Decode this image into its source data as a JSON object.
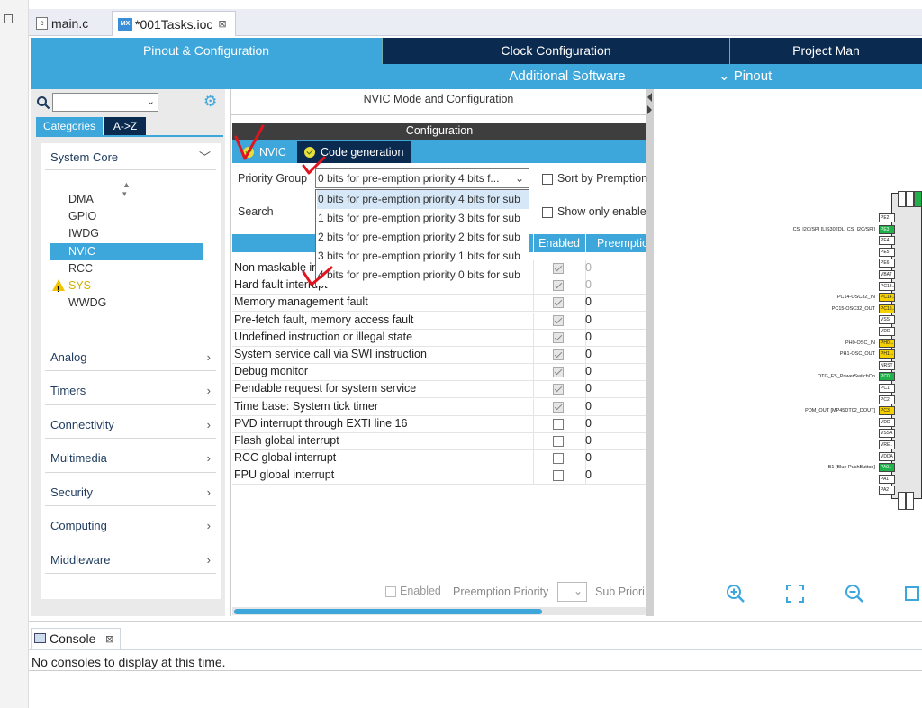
{
  "editor_tabs": [
    {
      "label": "main.c",
      "icon": "c-file-icon"
    },
    {
      "label": "*001Tasks.ioc",
      "icon": "mx-file-icon",
      "close": "⊠"
    }
  ],
  "nav": {
    "pinout_config": "Pinout & Configuration",
    "clock_config": "Clock Configuration",
    "project_manager": "Project Man",
    "additional_software": "Additional Software",
    "pinout": "Pinout"
  },
  "sidebar": {
    "search_value": "",
    "tab_categories": "Categories",
    "tab_az": "A->Z",
    "system_core": "System Core",
    "system_core_items": [
      "DMA",
      "GPIO",
      "IWDG",
      "NVIC",
      "RCC",
      "SYS",
      "WWDG"
    ],
    "selected": "NVIC",
    "warning_item": "SYS",
    "groups": [
      "Analog",
      "Timers",
      "Connectivity",
      "Multimedia",
      "Security",
      "Computing",
      "Middleware"
    ]
  },
  "main": {
    "title": "NVIC Mode and Configuration",
    "config_header": "Configuration",
    "tabs": [
      "NVIC",
      "Code generation"
    ],
    "priority_group_label": "Priority Group",
    "priority_group_value": "0 bits for pre-emption priority 4 bits f...",
    "search_label": "Search",
    "sort_label": "Sort by Premption",
    "show_only_label": "Show only enable",
    "dropdown_options": [
      "0 bits for pre-emption priority 4 bits for sub",
      "1 bits for pre-emption priority 3 bits for sub",
      "2 bits for pre-emption priority 2 bits for sub",
      "3 bits for pre-emption priority 1 bits for sub",
      "4 bits for pre-emption priority 0 bits for sub"
    ],
    "table": {
      "headers": [
        "Enabled",
        "Preemptio"
      ],
      "rows": [
        {
          "name": "Non maskable in",
          "enabled": true,
          "priority": "0",
          "dim": true
        },
        {
          "name": "Hard fault interrupt",
          "enabled": true,
          "priority": "0",
          "dim": true
        },
        {
          "name": "Memory management fault",
          "enabled": true,
          "priority": "0",
          "dim": false
        },
        {
          "name": "Pre-fetch fault, memory access fault",
          "enabled": true,
          "priority": "0",
          "dim": false
        },
        {
          "name": "Undefined instruction or illegal state",
          "enabled": true,
          "priority": "0",
          "dim": false
        },
        {
          "name": "System service call via SWI instruction",
          "enabled": true,
          "priority": "0",
          "dim": false
        },
        {
          "name": "Debug monitor",
          "enabled": true,
          "priority": "0",
          "dim": false
        },
        {
          "name": "Pendable request for system service",
          "enabled": true,
          "priority": "0",
          "dim": false
        },
        {
          "name": "Time base: System tick timer",
          "enabled": true,
          "priority": "0",
          "dim": false
        },
        {
          "name": "PVD interrupt through EXTI line 16",
          "enabled": false,
          "priority": "0",
          "dim": false
        },
        {
          "name": "Flash global interrupt",
          "enabled": false,
          "priority": "0",
          "dim": false
        },
        {
          "name": "RCC global interrupt",
          "enabled": false,
          "priority": "0",
          "dim": false
        },
        {
          "name": "FPU global interrupt",
          "enabled": false,
          "priority": "0",
          "dim": false
        }
      ]
    },
    "bottom": {
      "enabled_label": "Enabled",
      "preemption_label": "Preemption Priority",
      "sub_priority_label": "Sub Priori"
    }
  },
  "chip": {
    "pins": [
      {
        "name": "PE2",
        "color": "white"
      },
      {
        "name": "PE3",
        "color": "green",
        "label": "CS_I2C/SPI [LIS302DL_CS_I2C/SPI]"
      },
      {
        "name": "PE4",
        "color": "white"
      },
      {
        "name": "PE5",
        "color": "white"
      },
      {
        "name": "PE6",
        "color": "white"
      },
      {
        "name": "VBAT",
        "color": "white"
      },
      {
        "name": "PC13..",
        "color": "white"
      },
      {
        "name": "PC14..",
        "color": "yellow",
        "label": "PC14-OSC32_IN"
      },
      {
        "name": "PC15..",
        "color": "yellow",
        "label": "PC15-OSC32_OUT"
      },
      {
        "name": "VSS",
        "color": "white"
      },
      {
        "name": "VDD",
        "color": "white"
      },
      {
        "name": "PH0-..",
        "color": "yellow",
        "label": "PH0-OSC_IN"
      },
      {
        "name": "PH1-..",
        "color": "yellow",
        "label": "PH1-OSC_OUT"
      },
      {
        "name": "NRST",
        "color": "white"
      },
      {
        "name": "PC0",
        "color": "green",
        "label": "OTG_FS_PowerSwitchOn"
      },
      {
        "name": "PC1",
        "color": "white"
      },
      {
        "name": "PC2",
        "color": "white"
      },
      {
        "name": "PC3",
        "color": "yellow",
        "label": "PDM_OUT [MP45DT02_DOUT]"
      },
      {
        "name": "VDD",
        "color": "white"
      },
      {
        "name": "VSSA",
        "color": "white"
      },
      {
        "name": "VRE..",
        "color": "white"
      },
      {
        "name": "VDDA",
        "color": "white"
      },
      {
        "name": "PA0..",
        "color": "green",
        "label": "B1 [Blue PushButton]"
      },
      {
        "name": "PA1",
        "color": "white"
      },
      {
        "name": "PA2",
        "color": "white"
      }
    ],
    "tools": [
      "zoom-in-icon",
      "fit-icon",
      "zoom-out-icon",
      "export-icon"
    ]
  },
  "console": {
    "tab_label": "Console",
    "close": "⊠",
    "message": "No consoles to display at this time."
  },
  "colors": {
    "accent": "#3da6da",
    "navy": "#0b2a4f",
    "pin_green": "#22b04a",
    "pin_yellow": "#f4d000",
    "annotation_red": "#e0141e"
  }
}
